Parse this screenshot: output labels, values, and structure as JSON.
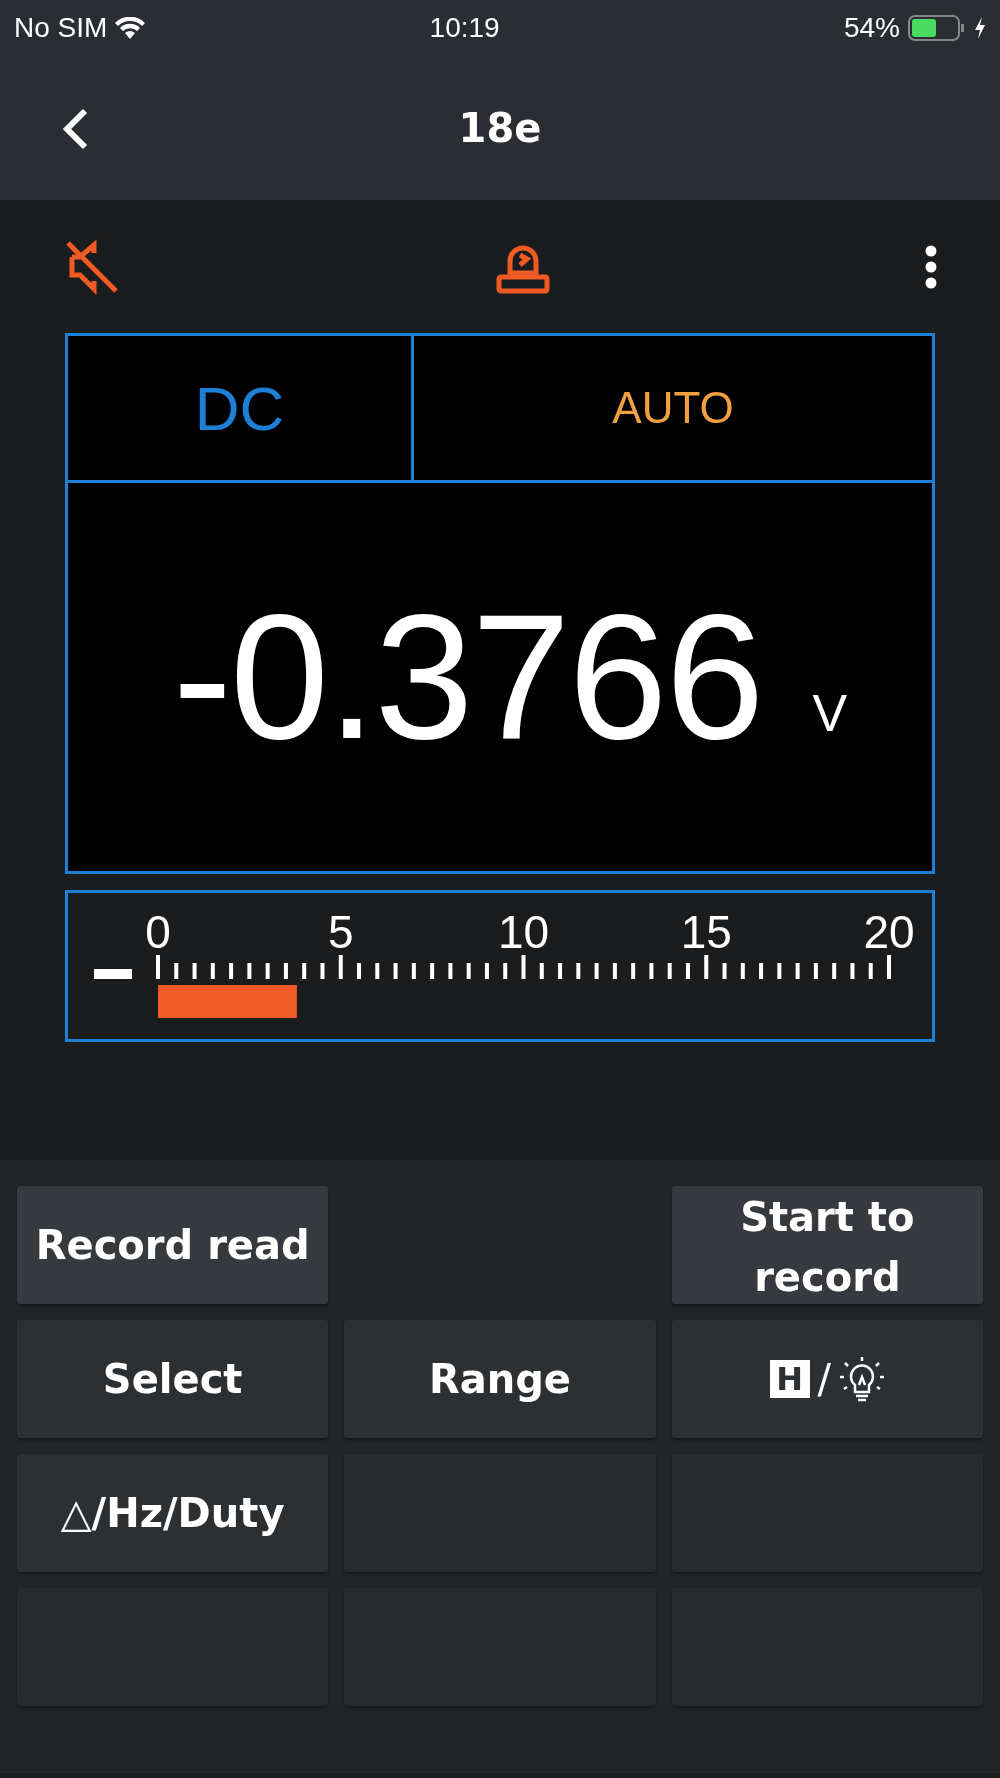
{
  "status_bar": {
    "carrier": "No SIM",
    "time": "10:19",
    "battery": "54%"
  },
  "nav": {
    "title": "18e"
  },
  "meter": {
    "coupling": "DC",
    "range_mode": "AUTO",
    "reading": "-0.3766",
    "unit": "V"
  },
  "bar_graph": {
    "negative": true,
    "level": 0.19,
    "scale_labels": [
      "0",
      "5",
      "10",
      "15",
      "20"
    ]
  },
  "buttons": [
    {
      "kind": "text",
      "label": "Record read"
    },
    {
      "kind": "none"
    },
    {
      "kind": "text",
      "label": "Start to record"
    },
    {
      "kind": "text",
      "label": "Select"
    },
    {
      "kind": "text",
      "label": "Range"
    },
    {
      "kind": "hold-light",
      "hold": "H",
      "separator": "/"
    },
    {
      "kind": "text",
      "label": "△/Hz/Duty"
    },
    {
      "kind": "empty"
    },
    {
      "kind": "empty"
    },
    {
      "kind": "empty"
    },
    {
      "kind": "empty"
    },
    {
      "kind": "empty"
    }
  ]
}
